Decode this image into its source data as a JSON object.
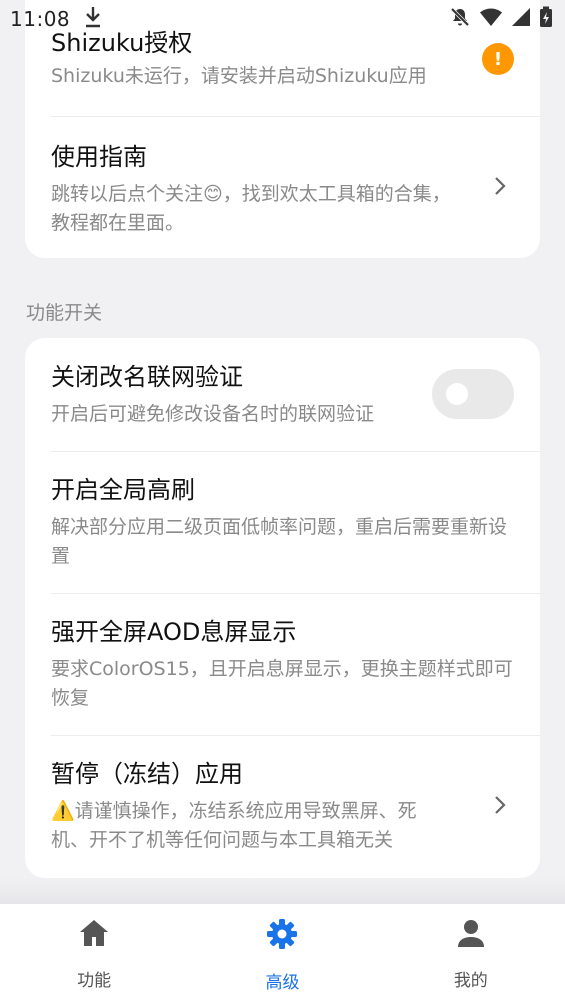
{
  "status_bar": {
    "time": "11:08"
  },
  "card1": {
    "items": [
      {
        "title": "Shizuku授权",
        "desc": "Shizuku未运行，请安装并启动Shizuku应用",
        "badge": "!"
      },
      {
        "title": "使用指南",
        "desc": "跳转以后点个关注😊，找到欢太工具箱的合集，教程都在里面。"
      }
    ]
  },
  "section_title": "功能开关",
  "card2": {
    "items": [
      {
        "title": "关闭改名联网验证",
        "desc": "开启后可避免修改设备名时的联网验证",
        "toggle_on": false
      },
      {
        "title": "开启全局高刷",
        "desc": "解决部分应用二级页面低帧率问题，重启后需要重新设置"
      },
      {
        "title": "强开全屏AOD息屏显示",
        "desc": "要求ColorOS15，且开启息屏显示，更换主题样式即可恢复"
      },
      {
        "title": "暂停（冻结）应用",
        "desc": "⚠️请谨慎操作，冻结系统应用导致黑屏、死机、开不了机等任何问题与本工具箱无关"
      }
    ]
  },
  "bottom_nav": {
    "items": [
      {
        "label": "功能",
        "icon": "home-icon",
        "active": false
      },
      {
        "label": "高级",
        "icon": "gear-icon",
        "active": true
      },
      {
        "label": "我的",
        "icon": "person-icon",
        "active": false
      }
    ],
    "active_color": "#1a73e8",
    "inactive_color": "#555555"
  },
  "colors": {
    "badge": "#ff9800",
    "background": "#f1f1f3",
    "card": "#ffffff"
  }
}
